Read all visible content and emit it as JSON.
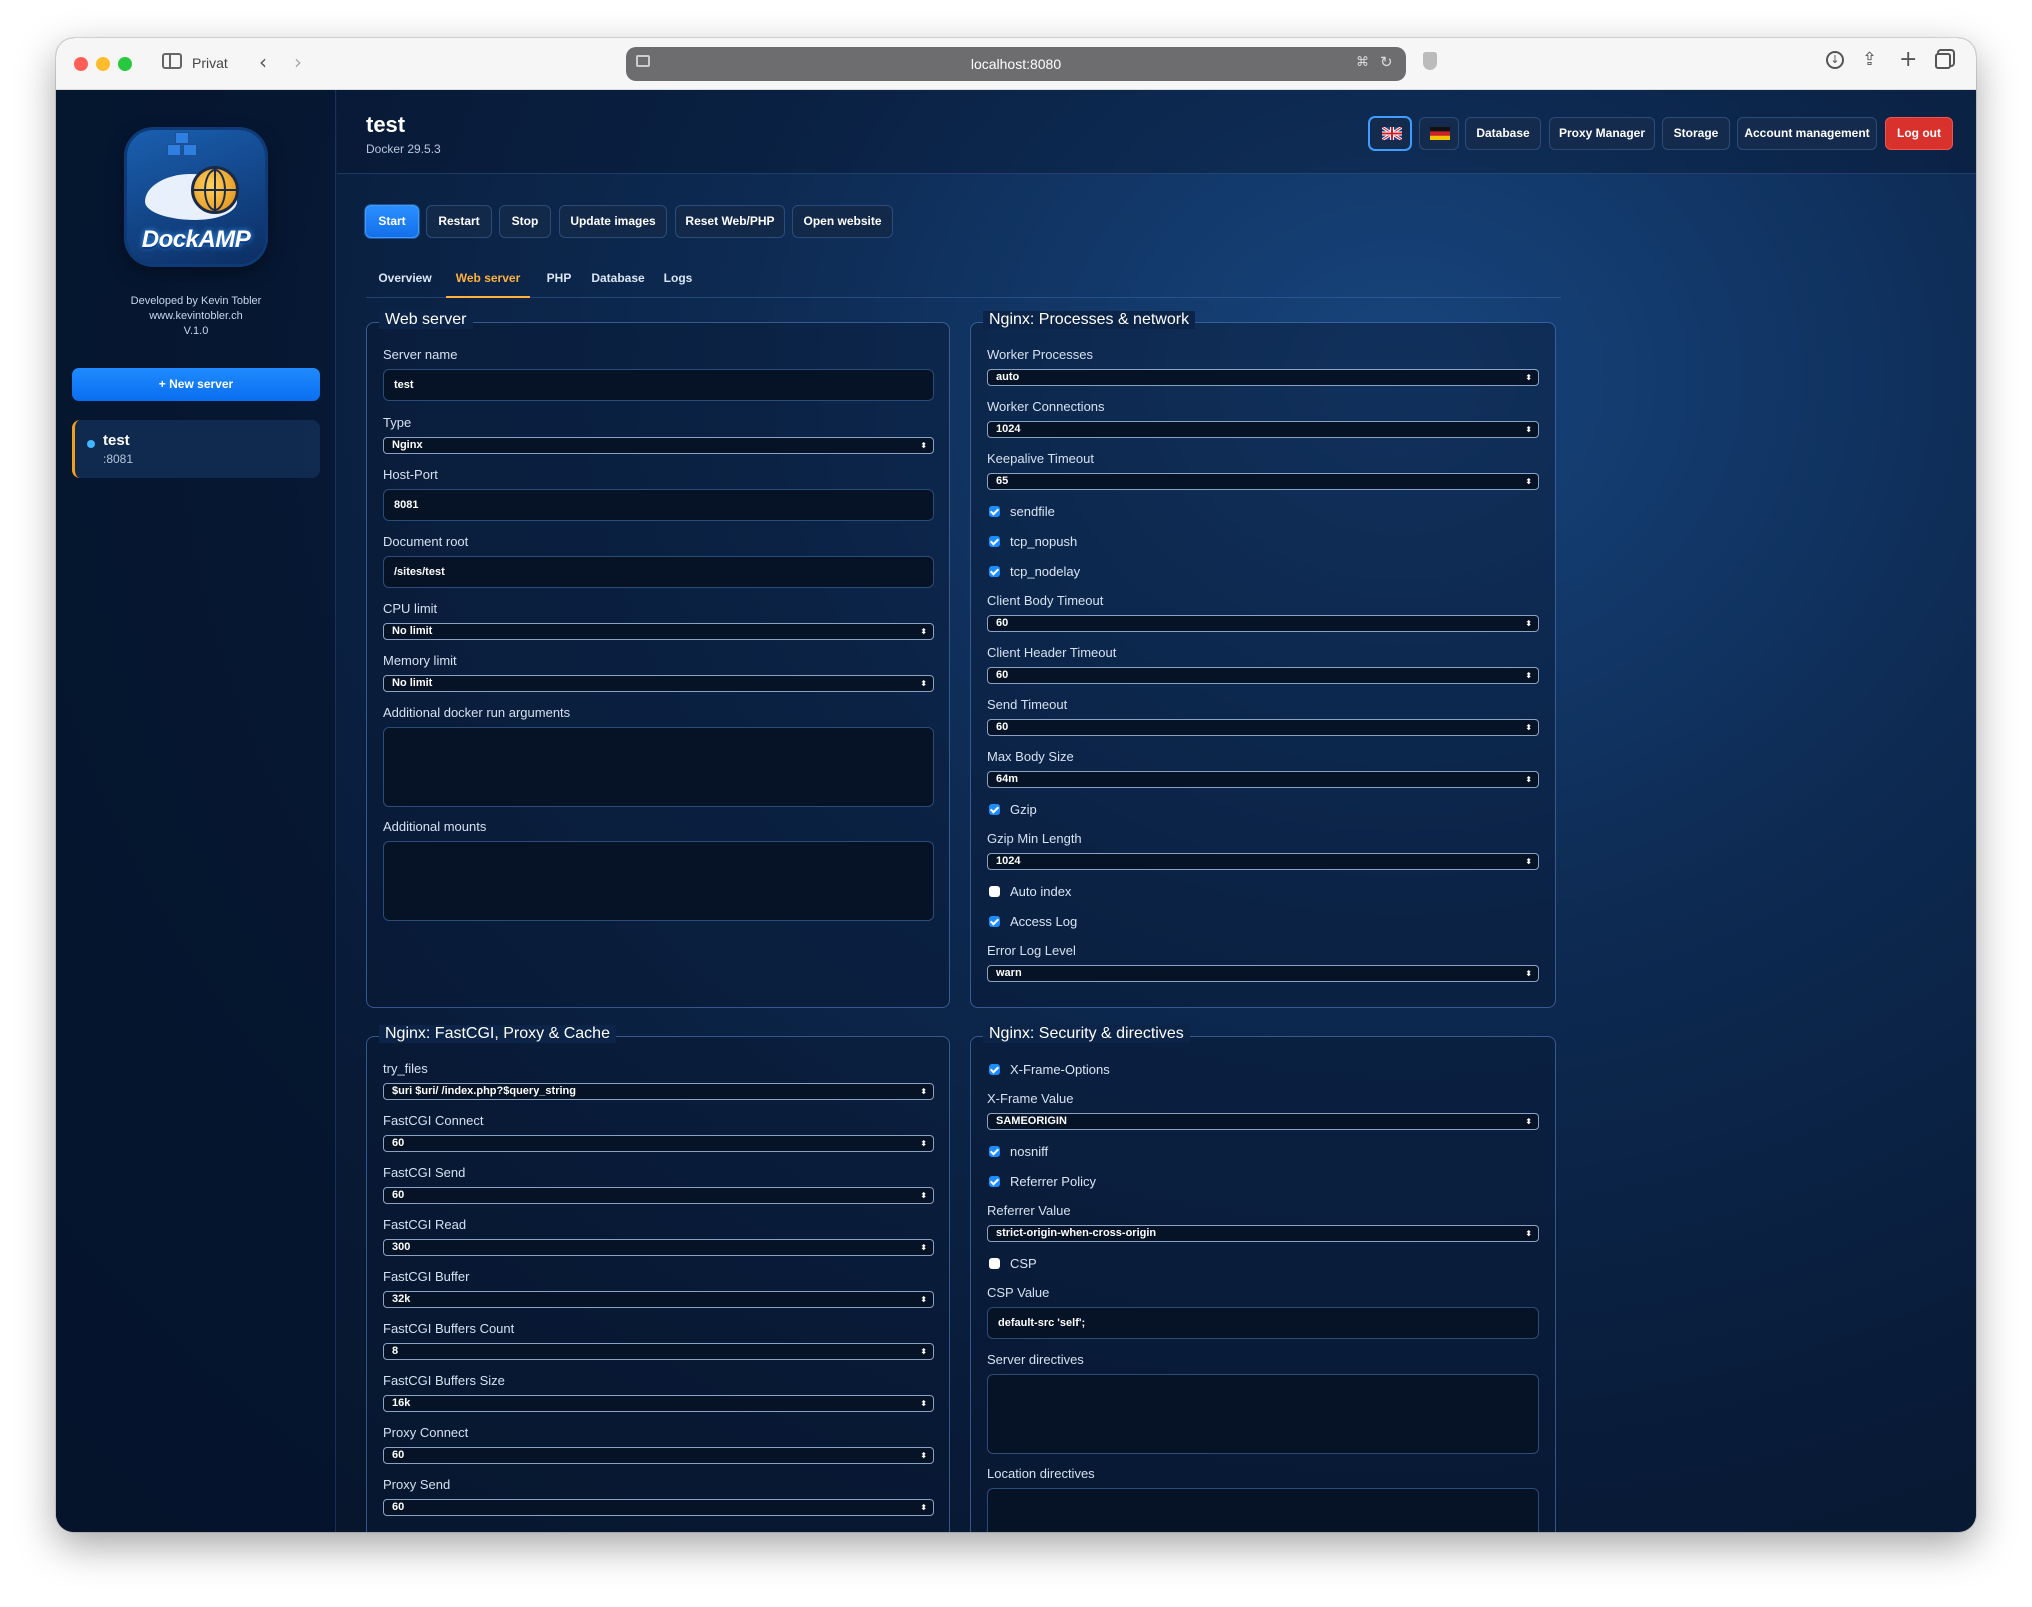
{
  "browser": {
    "private_label": "Privat",
    "url": "localhost:8080"
  },
  "sidebar": {
    "logo_text": "DockAMP",
    "developer": "Developed by Kevin Tobler",
    "website": "www.kevintobler.ch",
    "version": "V.1.0",
    "new_server_label": "+ New server",
    "servers": [
      {
        "name": "test",
        "port": ":8081"
      }
    ]
  },
  "header": {
    "title": "test",
    "subtitle": "Docker 29.5.3",
    "nav": [
      "Database",
      "Proxy Manager",
      "Storage",
      "Account management",
      "Log out"
    ]
  },
  "actions": [
    "Start",
    "Restart",
    "Stop",
    "Update images",
    "Reset Web/PHP",
    "Open website"
  ],
  "tabs": [
    "Overview",
    "Web server",
    "PHP",
    "Database",
    "Logs"
  ],
  "web_server": {
    "title": "Web server",
    "server_name_label": "Server name",
    "server_name": "test",
    "type_label": "Type",
    "type": "Nginx",
    "host_port_label": "Host-Port",
    "host_port": "8081",
    "doc_root_label": "Document root",
    "doc_root": "/sites/test",
    "cpu_label": "CPU limit",
    "cpu": "No limit",
    "memory_label": "Memory limit",
    "memory": "No limit",
    "docker_args_label": "Additional docker run arguments",
    "mounts_label": "Additional mounts"
  },
  "processes": {
    "title": "Nginx: Processes & network",
    "worker_processes_label": "Worker Processes",
    "worker_processes": "auto",
    "worker_connections_label": "Worker Connections",
    "worker_connections": "1024",
    "keepalive_label": "Keepalive Timeout",
    "keepalive": "65",
    "sendfile": "sendfile",
    "tcp_nopush": "tcp_nopush",
    "tcp_nodelay": "tcp_nodelay",
    "client_body_label": "Client Body Timeout",
    "client_body": "60",
    "client_header_label": "Client Header Timeout",
    "client_header": "60",
    "send_timeout_label": "Send Timeout",
    "send_timeout": "60",
    "max_body_label": "Max Body Size",
    "max_body": "64m",
    "gzip": "Gzip",
    "gzip_min_label": "Gzip Min Length",
    "gzip_min": "1024",
    "auto_index": "Auto index",
    "access_log": "Access Log",
    "error_log_label": "Error Log Level",
    "error_log": "warn"
  },
  "fastcgi": {
    "title": "Nginx: FastCGI, Proxy & Cache",
    "try_files_label": "try_files",
    "try_files": "$uri $uri/ /index.php?$query_string",
    "connect_label": "FastCGI Connect",
    "connect": "60",
    "send_label": "FastCGI Send",
    "send": "60",
    "read_label": "FastCGI Read",
    "read": "300",
    "buffer_label": "FastCGI Buffer",
    "buffer": "32k",
    "buffers_count_label": "FastCGI Buffers Count",
    "buffers_count": "8",
    "buffers_size_label": "FastCGI Buffers Size",
    "buffers_size": "16k",
    "proxy_connect_label": "Proxy Connect",
    "proxy_connect": "60",
    "proxy_send_label": "Proxy Send",
    "proxy_send": "60"
  },
  "security": {
    "title": "Nginx: Security & directives",
    "xframe_options": "X-Frame-Options",
    "xframe_value_label": "X-Frame Value",
    "xframe_value": "SAMEORIGIN",
    "nosniff": "nosniff",
    "referrer_policy": "Referrer Policy",
    "referrer_value_label": "Referrer Value",
    "referrer_value": "strict-origin-when-cross-origin",
    "csp": "CSP",
    "csp_value_label": "CSP Value",
    "csp_value": "default-src 'self';",
    "server_directives_label": "Server directives",
    "location_directives_label": "Location directives"
  },
  "colors": {
    "accent": "#1c8dff",
    "active_tab": "#ffb13b",
    "logout": "#d9312c",
    "background": "#0a1a33"
  }
}
